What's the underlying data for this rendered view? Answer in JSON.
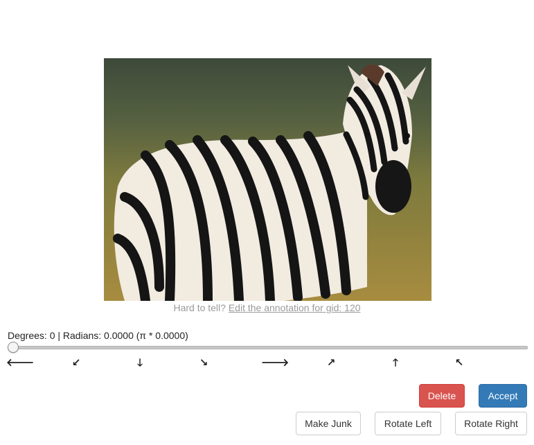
{
  "image": {
    "alt": "zebra",
    "colors": {
      "sky": "#3b4a35",
      "field": "#7c7a3c",
      "grass": "#a58b3c",
      "zebra_light": "#f2ebe0",
      "zebra_dark": "#151515"
    }
  },
  "hint": {
    "prefix": "Hard to tell?",
    "link": "Edit the annotation for gid: 120"
  },
  "rotation": {
    "degrees_label": "Degrees: 0 | Radians: 0.0000 (π * 0.0000)",
    "degrees": 0,
    "slider_fraction": 0
  },
  "arrows": [
    {
      "icon": "arrow-left-icon",
      "glyph": "🡐"
    },
    {
      "icon": "arrow-down-left-icon",
      "glyph": "↙"
    },
    {
      "icon": "arrow-down-icon",
      "glyph": "🡓"
    },
    {
      "icon": "arrow-down-right-icon",
      "glyph": "↘"
    },
    {
      "icon": "arrow-right-icon",
      "glyph": "🡒"
    },
    {
      "icon": "arrow-up-right-icon",
      "glyph": "↗"
    },
    {
      "icon": "arrow-up-icon",
      "glyph": "🡑"
    },
    {
      "icon": "arrow-up-left-icon",
      "glyph": "↖"
    }
  ],
  "buttons": {
    "delete": "Delete",
    "accept": "Accept",
    "make_junk": "Make Junk",
    "rotate_left": "Rotate Left",
    "rotate_right": "Rotate Right"
  },
  "colors": {
    "danger": "#d9534f",
    "primary": "#337ab7"
  }
}
